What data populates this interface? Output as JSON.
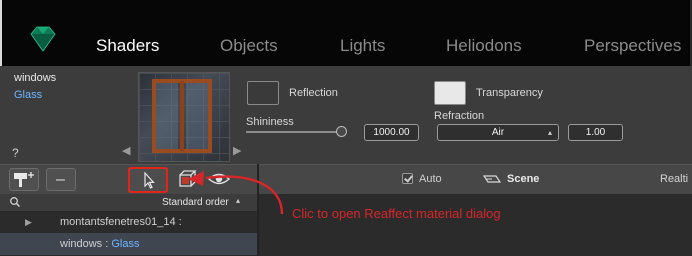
{
  "tabs": [
    {
      "label": "Shaders",
      "active": true
    },
    {
      "label": "Objects",
      "active": false
    },
    {
      "label": "Lights",
      "active": false
    },
    {
      "label": "Heliodons",
      "active": false
    },
    {
      "label": "Perspectives",
      "active": false
    }
  ],
  "shader": {
    "name": "windows",
    "type": "Glass",
    "help": "?",
    "thumb_prev": "◀",
    "thumb_next": "▶"
  },
  "properties": {
    "reflection_label": "Reflection",
    "transparency_label": "Transparency",
    "shininess_label": "Shininess",
    "shininess_value": "1000.00",
    "refraction_label": "Refraction",
    "refraction_medium": "Air",
    "refraction_value": "1.00"
  },
  "toolbar": {
    "minus_label": "–",
    "auto_label": "Auto",
    "auto_checked": true,
    "scene_label": "Scene",
    "realtime_label": "Realti"
  },
  "list": {
    "sort_label": "Standard order",
    "rows": [
      {
        "name": "montantsfenetres01_14 :",
        "type": ""
      },
      {
        "name": "windows : ",
        "type": "Glass"
      }
    ]
  },
  "annotation": {
    "text": "Clic to open Reaffect material dialog"
  },
  "colors": {
    "accent_red": "#e0261c",
    "link_blue": "#6cb6ff"
  }
}
